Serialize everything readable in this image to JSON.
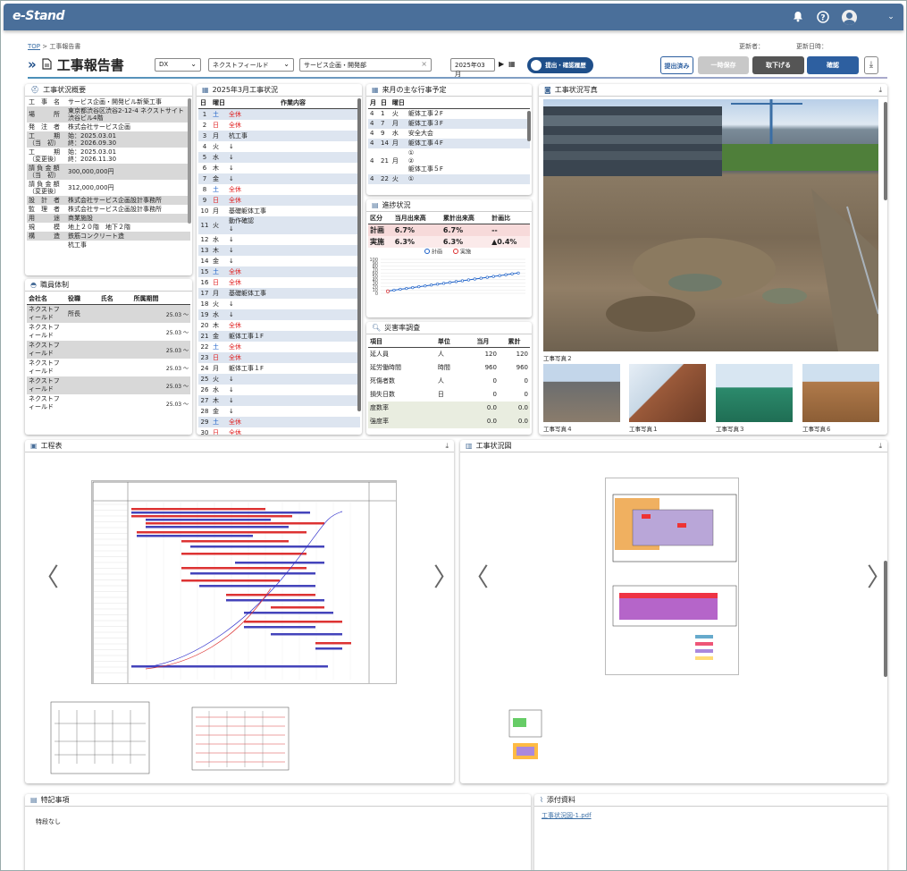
{
  "app": {
    "logo": "e-Stand",
    "bell_icon": "bell-icon",
    "help_icon": "help-icon",
    "user_icon": "avatar-icon"
  },
  "breadcrumb": {
    "home": "TOP",
    "sep": ">",
    "current": "工事報告書"
  },
  "updater": {
    "label": "更新者：",
    "value": ""
  },
  "updated_at": {
    "label": "更新日時：",
    "value": ""
  },
  "page": {
    "title": "工事報告書"
  },
  "filters": {
    "division": "DX",
    "company": "ネクストフィールド",
    "dept": "サービス企画・開発部",
    "month": "2025年03月"
  },
  "buttons": {
    "history": "提出・確認履歴",
    "submitted": "提出済み",
    "temp_save": "一時保存",
    "withdraw": "取下げる",
    "confirm": "確認"
  },
  "overview": {
    "title": "工事状況概要",
    "rows": [
      [
        "工　事　名",
        "サービス企画・開発ビル新築工事",
        ""
      ],
      [
        "場　　　所",
        "東京都渋谷区渋谷2-12-4 ネクストサイト渋谷ビル4階",
        "g"
      ],
      [
        "発　注　者",
        "株式会社サービス企画",
        ""
      ],
      [
        "工　　　期\n（当　初）",
        "始：2025.03.01\n終：2026.09.30",
        "g"
      ],
      [
        "工　　　期\n（変更後）",
        "始：2025.03.01\n終：2026.11.30",
        ""
      ],
      [
        "請 負 金 額\n（当　初）",
        "300,000,000円",
        "g"
      ],
      [
        "請 負 金 額\n（変更後）",
        "312,000,000円",
        ""
      ],
      [
        "設　計　者",
        "株式会社サービス企画設計事務所",
        "g"
      ],
      [
        "監　理　者",
        "株式会社サービス企画設計事務所",
        ""
      ],
      [
        "用　　　途",
        "商業施設",
        "g"
      ],
      [
        "規　　　模",
        "地上２０階　地下２階",
        ""
      ],
      [
        "構　　　造",
        "鉄筋コンクリート造",
        "g"
      ],
      [
        "",
        "杭工事",
        ""
      ]
    ]
  },
  "staff": {
    "title": "職員体制",
    "headers": [
      "会社名",
      "役職",
      "氏名",
      "所属期間"
    ],
    "rows": [
      [
        "ネクストフィールド",
        "所長",
        "",
        "25.03 ～",
        "g"
      ],
      [
        "ネクストフィールド",
        "",
        "",
        "25.03 ～",
        ""
      ],
      [
        "ネクストフィールド",
        "",
        "",
        "25.03 ～",
        "g"
      ],
      [
        "ネクストフィールド",
        "",
        "",
        "25.03 ～",
        ""
      ],
      [
        "ネクストフィールド",
        "",
        "",
        "25.03 ～",
        "g"
      ],
      [
        "ネクストフィールド",
        "",
        "",
        "25.03 ～",
        ""
      ]
    ]
  },
  "march": {
    "title": "2025年3月工事状況",
    "headers": [
      "日",
      "曜日",
      "作業内容"
    ],
    "rows": [
      [
        "1",
        "土",
        "全休",
        "b"
      ],
      [
        "2",
        "日",
        "全休",
        "r"
      ],
      [
        "3",
        "月",
        "杭工事",
        ""
      ],
      [
        "4",
        "火",
        "↓",
        ""
      ],
      [
        "5",
        "水",
        "↓",
        ""
      ],
      [
        "6",
        "木",
        "↓",
        ""
      ],
      [
        "7",
        "金",
        "↓",
        ""
      ],
      [
        "8",
        "土",
        "全休",
        "b"
      ],
      [
        "9",
        "日",
        "全休",
        "r"
      ],
      [
        "10",
        "月",
        "基礎躯体工事",
        ""
      ],
      [
        "11",
        "火",
        "動作確認\n↓",
        ""
      ],
      [
        "12",
        "水",
        "↓",
        ""
      ],
      [
        "13",
        "木",
        "↓",
        ""
      ],
      [
        "14",
        "金",
        "↓",
        ""
      ],
      [
        "15",
        "土",
        "全休",
        "b"
      ],
      [
        "16",
        "日",
        "全休",
        "r"
      ],
      [
        "17",
        "月",
        "基礎躯体工事",
        ""
      ],
      [
        "18",
        "火",
        "↓",
        ""
      ],
      [
        "19",
        "水",
        "↓",
        ""
      ],
      [
        "20",
        "木",
        "全休",
        ""
      ],
      [
        "21",
        "金",
        "躯体工事１F",
        ""
      ],
      [
        "22",
        "土",
        "全休",
        "b"
      ],
      [
        "23",
        "日",
        "全休",
        "r"
      ],
      [
        "24",
        "月",
        "躯体工事１F",
        ""
      ],
      [
        "25",
        "火",
        "↓",
        ""
      ],
      [
        "26",
        "水",
        "↓",
        ""
      ],
      [
        "27",
        "木",
        "↓",
        ""
      ],
      [
        "28",
        "金",
        "↓",
        ""
      ],
      [
        "29",
        "土",
        "全休",
        "b"
      ],
      [
        "30",
        "日",
        "全休",
        "r"
      ]
    ]
  },
  "next": {
    "title": "来月の主な行事予定",
    "headers": [
      "月",
      "日",
      "曜日"
    ],
    "rows": [
      [
        "4",
        "1",
        "火",
        "躯体工事２F"
      ],
      [
        "4",
        "7",
        "月",
        "躯体工事３F"
      ],
      [
        "4",
        "9",
        "水",
        "安全大会"
      ],
      [
        "4",
        "14",
        "月",
        "躯体工事４F"
      ],
      [
        "4",
        "21",
        "月",
        "①\n②\n躯体工事５F"
      ],
      [
        "4",
        "22",
        "火",
        "①"
      ]
    ]
  },
  "progress": {
    "title": "進捗状況",
    "headers": [
      "区分",
      "当月出来高",
      "累計出来高",
      "計画比"
    ],
    "rows": [
      [
        "計画",
        "6.7%",
        "6.7%",
        "--"
      ],
      [
        "実施",
        "6.3%",
        "6.3%",
        "▲0.4%"
      ]
    ],
    "legend": [
      "計画",
      "実施"
    ],
    "yticks": [
      "100",
      "90",
      "80",
      "70",
      "60",
      "50",
      "40",
      "30",
      "20",
      "10",
      "0"
    ]
  },
  "disaster": {
    "title": "災害率調査",
    "headers": [
      "項目",
      "単位",
      "当月",
      "累計"
    ],
    "rows": [
      [
        "延人員",
        "人",
        "120",
        "120"
      ],
      [
        "延労働時間",
        "時間",
        "960",
        "960"
      ],
      [
        "死傷者数",
        "人",
        "0",
        "0"
      ],
      [
        "損失日数",
        "日",
        "0",
        "0"
      ],
      [
        "度数率",
        "",
        "0.0",
        "0.0"
      ],
      [
        "強度率",
        "",
        "0.0",
        "0.0"
      ]
    ]
  },
  "photos": {
    "title": "工事状況写真",
    "main_caption": "工事写真２",
    "thumbs": [
      "工事写真４",
      "工事写真１",
      "工事写真３",
      "工事写真６"
    ]
  },
  "schedule": {
    "title": "工程表"
  },
  "status_map": {
    "title": "工事状況図"
  },
  "remarks": {
    "title": "特記事項",
    "text": "特段なし"
  },
  "attachments": {
    "title": "添付資料",
    "file": "工事状況図-1.pdf"
  },
  "colors": {
    "header": "#4a6f9a",
    "accent": "#1f4f8a",
    "dark_button": "#555555",
    "blue_button": "#2d5fa0"
  }
}
